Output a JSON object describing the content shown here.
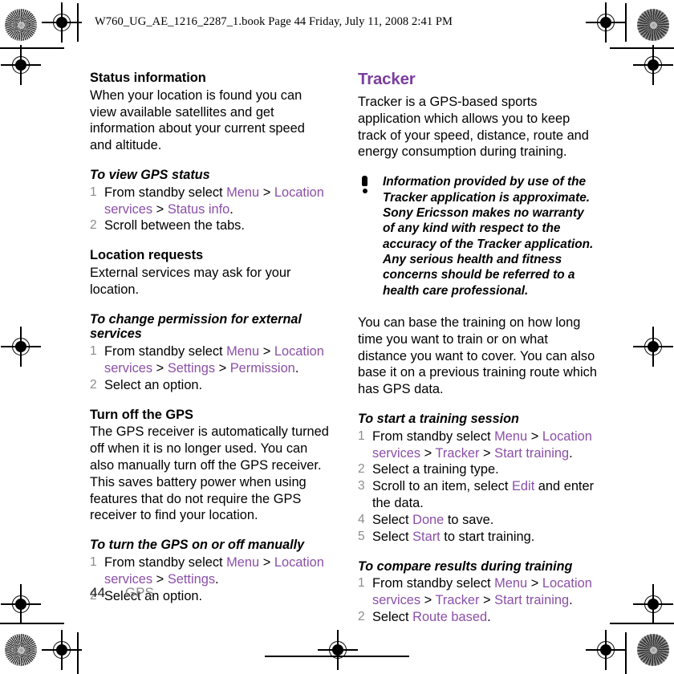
{
  "file_header": "W760_UG_AE_1216_2287_1.book  Page 44  Friday, July 11, 2008  2:41 PM",
  "colors": {
    "heading_purple": "#7B3F9E",
    "link_purple": "#8B4FA8",
    "step_number_gray": "#8c8c8c",
    "footer_section_gray": "#8a8a8a"
  },
  "left_column": {
    "status_information": {
      "heading": "Status information",
      "body": "When your location is found you can view available satellites and get information about your current speed and altitude."
    },
    "view_gps_status": {
      "heading": "To view GPS status",
      "steps": [
        {
          "num": "1",
          "prefix": "From standby select ",
          "links": [
            "Menu",
            "Location services",
            "Status info"
          ],
          "suffix": "."
        },
        {
          "num": "2",
          "text": "Scroll between the tabs."
        }
      ]
    },
    "location_requests": {
      "heading": "Location requests",
      "body": "External services may ask for your location."
    },
    "change_permission": {
      "heading": "To change permission for external services",
      "steps": [
        {
          "num": "1",
          "prefix": "From standby select ",
          "links": [
            "Menu",
            "Location services",
            "Settings",
            "Permission"
          ],
          "suffix": "."
        },
        {
          "num": "2",
          "text": "Select an option."
        }
      ]
    },
    "turn_off_gps": {
      "heading": "Turn off the GPS",
      "body": "The GPS receiver is automatically turned off when it is no longer used. You can also manually turn off the GPS receiver. This saves battery power when using features that do not require the GPS receiver to find your location."
    },
    "turn_gps_manually": {
      "heading": "To turn the GPS on or off manually",
      "steps": [
        {
          "num": "1",
          "prefix": "From standby select ",
          "links": [
            "Menu",
            "Location services",
            "Settings"
          ],
          "suffix": "."
        },
        {
          "num": "2",
          "text": "Select an option."
        }
      ]
    }
  },
  "right_column": {
    "tracker": {
      "heading": "Tracker",
      "body": "Tracker is a GPS-based sports application which allows you to keep track of your speed, distance, route and energy consumption during training."
    },
    "note": {
      "icon": "exclamation-icon",
      "text": "Information provided by use of the Tracker application is approximate. Sony Ericsson makes no warranty of any kind with respect to the accuracy of the Tracker application. Any serious health and fitness concerns should be referred to a health care professional."
    },
    "training_basis": {
      "body": "You can base the training on how long time you want to train or on what distance you want to cover. You can also base it on a previous training route which has GPS data."
    },
    "start_training": {
      "heading": "To start a training session",
      "steps": [
        {
          "num": "1",
          "prefix": "From standby select ",
          "links": [
            "Menu",
            "Location services",
            "Tracker",
            "Start training"
          ],
          "suffix": "."
        },
        {
          "num": "2",
          "text": "Select a training type."
        },
        {
          "num": "3",
          "prefix": "Scroll to an item, select ",
          "links": [
            "Edit"
          ],
          "suffix": " and enter the data."
        },
        {
          "num": "4",
          "prefix": "Select ",
          "links": [
            "Done"
          ],
          "suffix": " to save."
        },
        {
          "num": "5",
          "prefix": "Select ",
          "links": [
            "Start"
          ],
          "suffix": " to start training."
        }
      ]
    },
    "compare_results": {
      "heading": "To compare results during training",
      "steps": [
        {
          "num": "1",
          "prefix": "From standby select ",
          "links": [
            "Menu",
            "Location services",
            "Tracker",
            "Start training"
          ],
          "suffix": "."
        },
        {
          "num": "2",
          "prefix": "Select ",
          "links": [
            "Route based"
          ],
          "suffix": "."
        }
      ]
    }
  },
  "footer": {
    "page_number": "44",
    "section": "GPS"
  }
}
